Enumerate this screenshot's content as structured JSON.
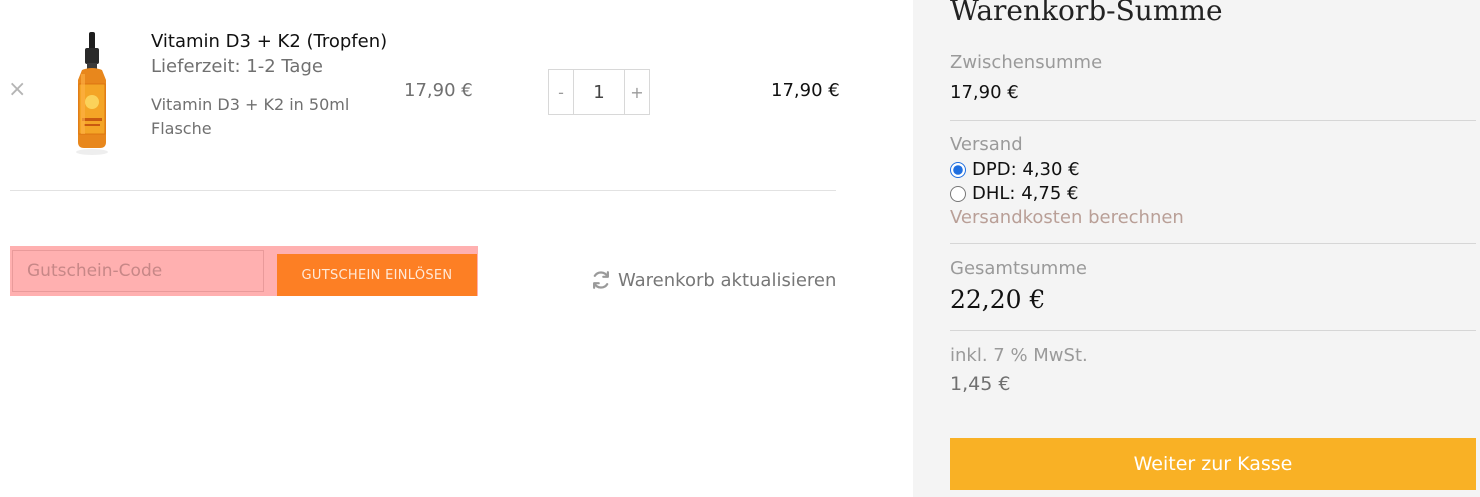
{
  "cart": {
    "remove_icon": "×",
    "product": {
      "name": "Vitamin D3 + K2 (Tropfen)",
      "delivery": "Lieferzeit: 1-2 Tage",
      "description": "Vitamin D3 + K2 in 50ml Flasche",
      "price": "17,90 €",
      "quantity": "1",
      "subtotal": "17,90 €"
    },
    "qty_minus": "-",
    "qty_plus": "+",
    "coupon_placeholder": "Gutschein-Code",
    "coupon_button": "GUTSCHEIN EINLÖSEN",
    "update_cart": "Warenkorb aktualisieren"
  },
  "totals": {
    "title": "Warenkorb-Summe",
    "subtotal_label": "Zwischensumme",
    "subtotal_value": "17,90 €",
    "shipping_label": "Versand",
    "shipping_options": [
      {
        "label": "DPD: 4,30 €",
        "selected": true
      },
      {
        "label": "DHL: 4,75 €",
        "selected": false
      }
    ],
    "calc_shipping": "Versandkosten berechnen",
    "total_label": "Gesamtsumme",
    "total_value": "22,20 €",
    "tax_label": "inkl. 7 % MwSt.",
    "tax_value": "1,45 €",
    "checkout_button": "Weiter zur Kasse"
  },
  "colors": {
    "coupon_button": "#fd7f24",
    "checkout_button": "#f9b125",
    "coupon_highlight": "#ffb0b0",
    "panel_background": "#f4f4f4"
  },
  "icons": {
    "remove": "close-icon",
    "update": "refresh-icon",
    "product": "dropper-bottle-image"
  }
}
